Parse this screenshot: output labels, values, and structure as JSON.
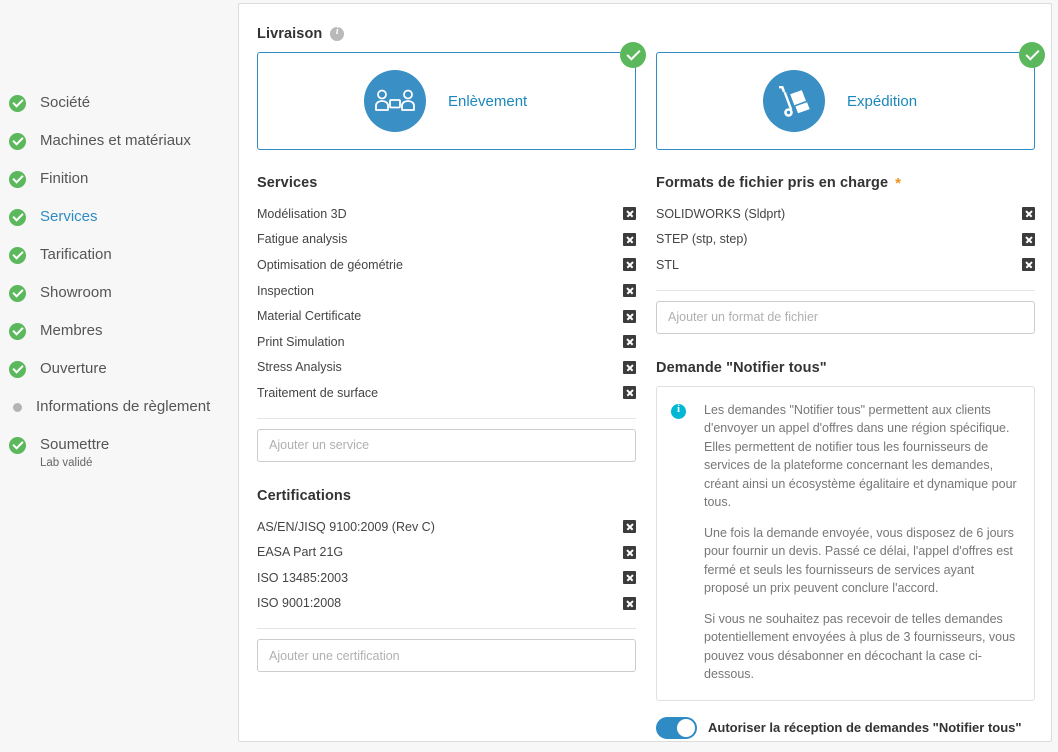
{
  "sidebar": {
    "items": [
      {
        "label": "Société",
        "state": "done",
        "sub": ""
      },
      {
        "label": "Machines et matériaux",
        "state": "done",
        "sub": ""
      },
      {
        "label": "Finition",
        "state": "done",
        "sub": ""
      },
      {
        "label": "Services",
        "state": "done",
        "sub": "",
        "active": true
      },
      {
        "label": "Tarification",
        "state": "done",
        "sub": ""
      },
      {
        "label": "Showroom",
        "state": "done",
        "sub": ""
      },
      {
        "label": "Membres",
        "state": "done",
        "sub": ""
      },
      {
        "label": "Ouverture",
        "state": "done",
        "sub": ""
      },
      {
        "label": "Informations de règlement",
        "state": "pending",
        "sub": ""
      },
      {
        "label": "Soumettre",
        "state": "done",
        "sub": "Lab validé"
      }
    ]
  },
  "delivery": {
    "title": "Livraison",
    "info_icon": "info-icon",
    "cards": [
      {
        "label": "Enlèvement",
        "icon": "handover-people-icon",
        "selected": true
      },
      {
        "label": "Expédition",
        "icon": "hand-truck-icon",
        "selected": true
      }
    ]
  },
  "services": {
    "title": "Services",
    "items": [
      "Modélisation 3D",
      "Fatigue analysis",
      "Optimisation de géométrie",
      "Inspection",
      "Material Certificate",
      "Print Simulation",
      "Stress Analysis",
      "Traitement de surface"
    ],
    "add_placeholder": "Ajouter un service",
    "add_value": ""
  },
  "certifications": {
    "title": "Certifications",
    "items": [
      "AS/EN/JISQ 9100:2009 (Rev C)",
      "EASA Part 21G",
      "ISO 13485:2003",
      "ISO 9001:2008"
    ],
    "add_placeholder": "Ajouter une certification",
    "add_value": ""
  },
  "file_formats": {
    "title": "Formats de fichier pris en charge",
    "required_mark": "*",
    "required_color": "#e8931e",
    "items": [
      "SOLIDWORKS (Sldprt)",
      "STEP (stp, step)",
      "STL"
    ],
    "add_placeholder": "Ajouter un format de fichier",
    "add_value": ""
  },
  "notify_all": {
    "title": "Demande \"Notifier tous\"",
    "info_icon": "info-circle-icon",
    "paragraphs": [
      "Les demandes \"Notifier tous\" permettent aux clients d'envoyer un appel d'offres dans une région spécifique. Elles permettent de notifier tous les fournisseurs de services de la plateforme concernant les demandes, créant ainsi un écosystème égalitaire et dynamique pour tous.",
      "Une fois la demande envoyée, vous disposez de 6 jours pour fournir un devis. Passé ce délai, l'appel d'offres est fermé et seuls les fournisseurs de services ayant proposé un prix peuvent conclure l'accord.",
      "Si vous ne souhaitez pas recevoir de telles demandes potentiellement envoyées à plus de 3 fournisseurs, vous pouvez vous désabonner en décochant la case ci-dessous."
    ],
    "toggle_label": "Autoriser la réception de demandes \"Notifier tous\"",
    "toggle_on": true
  },
  "colors": {
    "accent_blue": "#2e8bc4",
    "link_blue": "#1b87bc",
    "success_green": "#5cb85c",
    "info_cyan": "#00b8d4",
    "required_orange": "#e8931e",
    "page_bg": "#f7f7f7"
  }
}
